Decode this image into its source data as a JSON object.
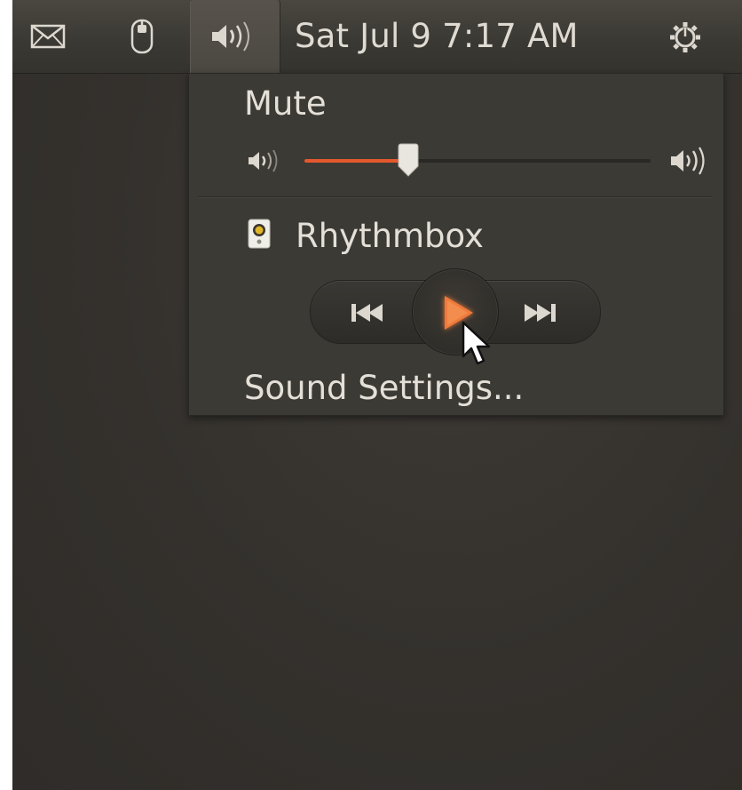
{
  "panel": {
    "clock": "Sat Jul 9  7:17 AM",
    "icons": [
      "mail-icon",
      "mouse-icon",
      "speaker-icon",
      "power-gear-icon"
    ]
  },
  "sound_menu": {
    "mute_label": "Mute",
    "volume_level": 0.3,
    "player_name": "Rhythmbox",
    "player_icon": "rhythmbox-speaker-icon",
    "controls": [
      "previous-icon",
      "play-icon",
      "next-icon"
    ],
    "settings_label": "Sound Settings..."
  },
  "colors": {
    "panel_bg": "#3e3c37",
    "menu_bg": "#3c3a35",
    "accent": "#e5582d",
    "text": "#e4e0d8"
  }
}
